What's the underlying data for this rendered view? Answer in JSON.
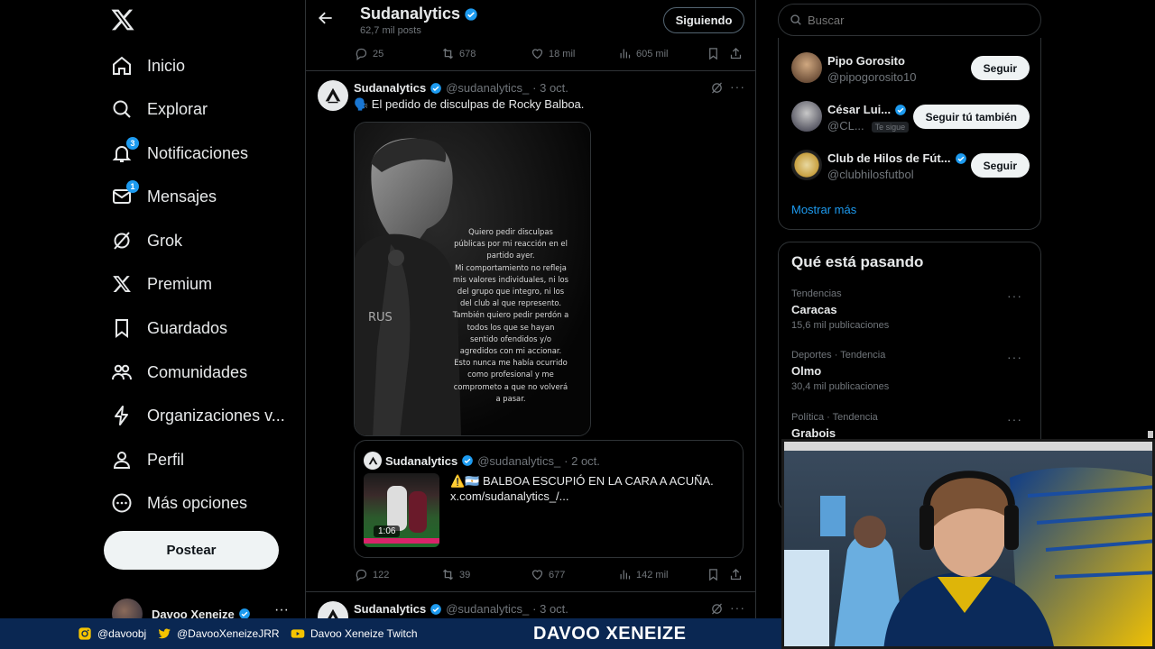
{
  "colors": {
    "accent": "#1d9bf0",
    "background": "#000000",
    "banner": "#0a2752"
  },
  "nav": {
    "items": [
      {
        "label": "Inicio",
        "icon": "home-icon"
      },
      {
        "label": "Explorar",
        "icon": "search-icon"
      },
      {
        "label": "Notificaciones",
        "icon": "bell-icon",
        "badge": "3"
      },
      {
        "label": "Mensajes",
        "icon": "mail-icon",
        "badge": "1"
      },
      {
        "label": "Grok",
        "icon": "grok-icon"
      },
      {
        "label": "Premium",
        "icon": "x-logo-icon"
      },
      {
        "label": "Guardados",
        "icon": "bookmark-icon"
      },
      {
        "label": "Comunidades",
        "icon": "communities-icon"
      },
      {
        "label": "Organizaciones v...",
        "icon": "lightning-icon"
      },
      {
        "label": "Perfil",
        "icon": "person-icon"
      },
      {
        "label": "Más opciones",
        "icon": "more-circle-icon"
      }
    ],
    "post_button": "Postear",
    "account_name": "Davoo Xeneize"
  },
  "header": {
    "title": "Sudanalytics",
    "subtitle": "62,7 mil posts",
    "follow_button": "Siguiendo"
  },
  "prev_tweet_actions": {
    "replies": "25",
    "reposts": "678",
    "likes": "18 mil",
    "views": "605 mil"
  },
  "tweet": {
    "name": "Sudanalytics",
    "handle": "@sudanalytics_",
    "date": "· 3 oct.",
    "text": "🗣️ El pedido de disculpas de Rocky Balboa.",
    "image_text": "Quiero pedir disculpas públicas por mi reacción en el partido ayer.\nMi comportamiento no refleja mis valores individuales, ni los del grupo que integro, ni los del club al que represento.\nTambién quiero pedir perdón a todos los que se hayan sentido ofendidos y/o agredidos con mi accionar.\nEsto nunca me había ocurrido como profesional y me comprometo a que no volverá a pasar.",
    "quote": {
      "name": "Sudanalytics",
      "handle": "@sudanalytics_",
      "date": "· 2 oct.",
      "text": "⚠️🇦🇷 BALBOA ESCUPIÓ EN LA CARA A ACUÑA.",
      "link": "x.com/sudanalytics_/...",
      "duration": "1:06"
    },
    "actions": {
      "replies": "122",
      "reposts": "39",
      "likes": "677",
      "views": "142 mil"
    }
  },
  "next_tweet": {
    "name": "Sudanalytics",
    "handle": "@sudanalytics_",
    "date": "· 3 oct."
  },
  "search": {
    "placeholder": "Buscar"
  },
  "who_to_follow": [
    {
      "name": "Pipo Gorosito",
      "handle": "@pipogorosito10",
      "button": "Seguir",
      "verified": false
    },
    {
      "name": "César Lui...",
      "handle": "@CL...",
      "follows_you": "Te sigue",
      "button": "Seguir tú también",
      "verified": true
    },
    {
      "name": "Club de Hilos de Fút...",
      "handle": "@clubhilosfutbol",
      "button": "Seguir",
      "verified": true
    }
  ],
  "show_more": "Mostrar más",
  "trends": {
    "title": "Qué está pasando",
    "items": [
      {
        "category": "Tendencias",
        "name": "Caracas",
        "count": "15,6 mil publicaciones"
      },
      {
        "category": "Deportes · Tendencia",
        "name": "Olmo",
        "count": "30,4 mil publicaciones"
      },
      {
        "category": "Política · Tendencia",
        "name": "Grabois",
        "count": ""
      }
    ]
  },
  "banner": {
    "instagram": "@davoobj",
    "twitter": "@DavooXeneizeJRR",
    "youtube": "Davoo Xeneize Twitch",
    "name": "DAVOO XENEIZE"
  }
}
